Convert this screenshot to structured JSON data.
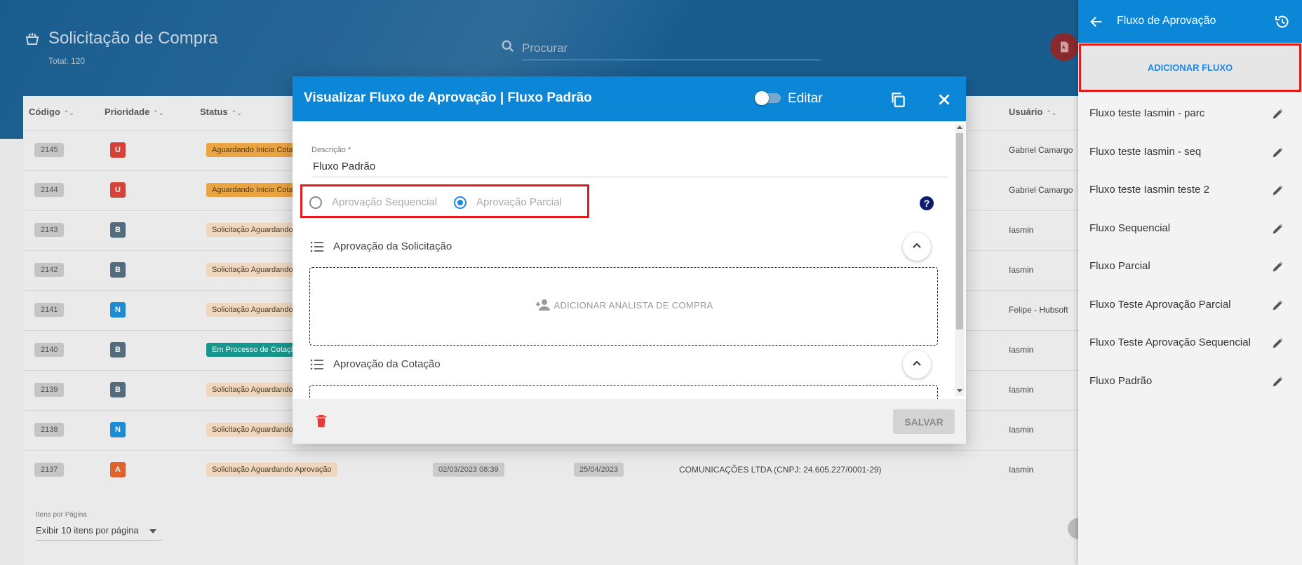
{
  "app": {
    "title": "Solicitação de Compra",
    "total": "Total: 120",
    "search_placeholder": "Procurar",
    "columns": [
      "Código",
      "Prioridade",
      "Status",
      "Usuário"
    ],
    "rows": [
      {
        "code": "2145",
        "priority": "U",
        "priority_color": "#d9443b",
        "status": "Aguardando Início Cotação",
        "status_bg": "#f0a844",
        "status_fg": "#5a3a08",
        "user": "Gabriel Camargo"
      },
      {
        "code": "2144",
        "priority": "U",
        "priority_color": "#d9443b",
        "status": "Aguardando Início Cotação",
        "status_bg": "#f0a844",
        "status_fg": "#5a3a08",
        "user": "Gabriel Camargo"
      },
      {
        "code": "2143",
        "priority": "B",
        "priority_color": "#56707f",
        "status": "Solicitação Aguardando Aprovação",
        "status_bg": "#f3dcc2",
        "status_fg": "#4d3b28",
        "user": "Iasmin"
      },
      {
        "code": "2142",
        "priority": "B",
        "priority_color": "#56707f",
        "status": "Solicitação Aguardando Aprovação",
        "status_bg": "#f3dcc2",
        "status_fg": "#4d3b28",
        "user": "Iasmin"
      },
      {
        "code": "2141",
        "priority": "N",
        "priority_color": "#1f8fd8",
        "status": "Solicitação Aguardando Aprovação",
        "status_bg": "#f3dcc2",
        "status_fg": "#4d3b28",
        "user": "Felipe - Hubsoft"
      },
      {
        "code": "2140",
        "priority": "B",
        "priority_color": "#56707f",
        "status": "Em Processo de Cotação",
        "status_bg": "#17998f",
        "status_fg": "#ffffff",
        "user": "Iasmin"
      },
      {
        "code": "2139",
        "priority": "B",
        "priority_color": "#56707f",
        "status": "Solicitação Aguardando Aprovação",
        "status_bg": "#f3dcc2",
        "status_fg": "#4d3b28",
        "user": "Iasmin"
      },
      {
        "code": "2138",
        "priority": "N",
        "priority_color": "#1f8fd8",
        "status": "Solicitação Aguardando Aprovação",
        "status_bg": "#f3dcc2",
        "status_fg": "#4d3b28",
        "user": "Iasmin"
      },
      {
        "code": "2137",
        "priority": "A",
        "priority_color": "#e4632d",
        "status": "Solicitação Aguardando Aprovação",
        "status_bg": "#f3dcc2",
        "status_fg": "#4d3b28",
        "user": "Iasmin",
        "date1": "02/03/2023 08:39",
        "date2": "25/04/2023",
        "supplier": "COMUNICAÇÕES LTDA (CNPJ: 24.605.227/0001-29)"
      }
    ],
    "items_per_page_label": "Itens por Página",
    "items_per_page_value": "Exibir 10 itens por página"
  },
  "modal": {
    "title": "Visualizar Fluxo de Aprovação | Fluxo Padrão",
    "edit_label": "Editar",
    "description_label": "Descrição *",
    "description_value": "Fluxo Padrão",
    "radio_sequential": "Aprovação Sequencial",
    "radio_partial": "Aprovação Parcial",
    "selected": "partial",
    "help": "?",
    "section1_title": "Aprovação da Solicitação",
    "add_analyst": "ADICIONAR ANALISTA DE COMPRA",
    "section2_title": "Aprovação da Cotação",
    "save_label": "SALVAR"
  },
  "panel": {
    "title": "Fluxo de Aprovação",
    "add_flow": "ADICIONAR FLUXO",
    "flows": [
      "Fluxo teste Iasmin - parc",
      "Fluxo teste Iasmin - seq",
      "Fluxo teste Iasmin teste 2",
      "Fluxo Sequencial",
      "Fluxo Parcial",
      "Fluxo Teste Aprovação Parcial",
      "Fluxo Teste Aprovação Sequencial",
      "Fluxo Padrão"
    ]
  },
  "colors": {
    "primary": "#0c87d8",
    "header_bg": "#1a5f92",
    "highlight": "#e21b1b",
    "radio_active": "#1e88e5"
  }
}
